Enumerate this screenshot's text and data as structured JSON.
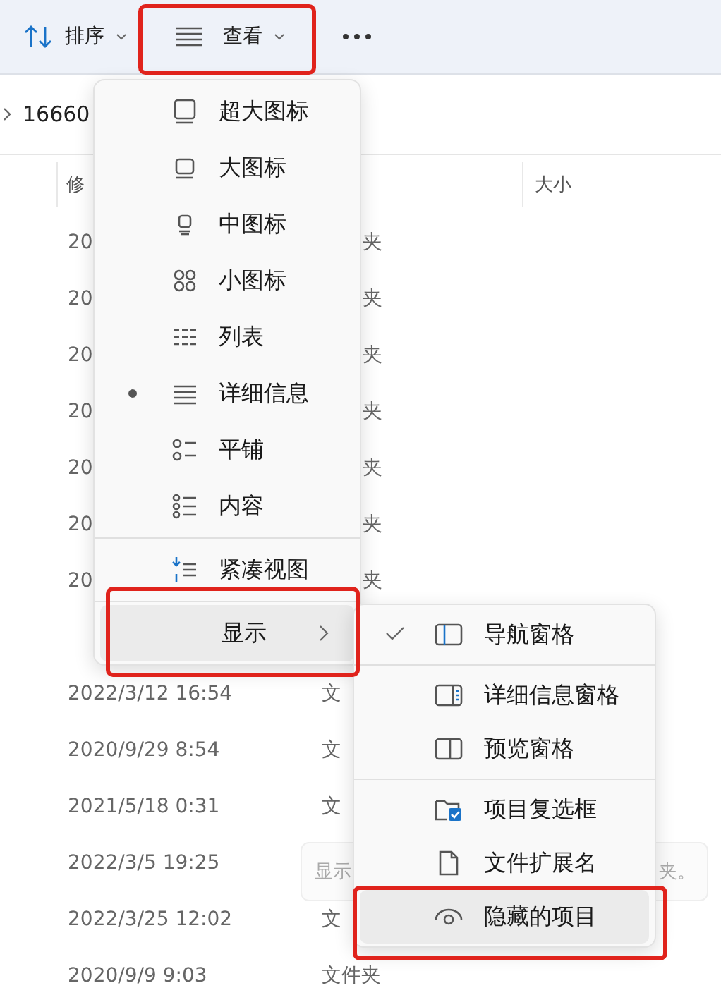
{
  "toolbar": {
    "sort": {
      "label": "排序"
    },
    "view": {
      "label": "查看"
    }
  },
  "breadcrumb": {
    "folder": "16660"
  },
  "table": {
    "columns": [
      "修",
      "大小"
    ],
    "rows": [
      {
        "kind": "covered",
        "date": "20",
        "type": "夹"
      },
      {
        "kind": "covered",
        "date": "20",
        "type": "夹"
      },
      {
        "kind": "covered",
        "date": "20",
        "type": "夹"
      },
      {
        "kind": "covered",
        "date": "20",
        "type": "夹"
      },
      {
        "kind": "covered",
        "date": "20",
        "type": "夹"
      },
      {
        "kind": "covered",
        "date": "20",
        "type": "夹"
      },
      {
        "kind": "covered",
        "date": "20",
        "type": "夹"
      },
      {
        "kind": "hidden"
      },
      {
        "kind": "partial",
        "date": "2022/3/12 16:54",
        "type": "文"
      },
      {
        "kind": "partial",
        "date": "2020/9/29 8:54",
        "type": "文"
      },
      {
        "kind": "partial",
        "date": "2021/5/18 0:31",
        "type": "文"
      },
      {
        "kind": "partial",
        "date": "2022/3/5 19:25"
      },
      {
        "kind": "partial",
        "date": "2022/3/25 12:02",
        "type": "文"
      },
      {
        "kind": "full",
        "date": "2020/9/9 9:03",
        "type": "文件夹"
      }
    ]
  },
  "view_menu": {
    "items": [
      {
        "label": "超大图标",
        "selected": false
      },
      {
        "label": "大图标",
        "selected": false
      },
      {
        "label": "中图标",
        "selected": false
      },
      {
        "label": "小图标",
        "selected": false
      },
      {
        "label": "列表",
        "selected": false
      },
      {
        "label": "详细信息",
        "selected": true
      },
      {
        "label": "平铺",
        "selected": false
      },
      {
        "label": "内容",
        "selected": false
      },
      {
        "label": "紧凑视图",
        "selected": false
      }
    ],
    "show": {
      "label": "显示",
      "expanded": true
    }
  },
  "show_menu": {
    "items": [
      {
        "label": "导航窗格",
        "checked": true,
        "highlighted": false
      },
      {
        "label": "详细信息窗格",
        "checked": false,
        "highlighted": false
      },
      {
        "label": "预览窗格",
        "checked": false,
        "highlighted": false
      },
      {
        "label": "项目复选框",
        "checked": false,
        "highlighted": false
      },
      {
        "label": "文件扩展名",
        "checked": false,
        "highlighted": false
      },
      {
        "label": "隐藏的项目",
        "checked": false,
        "highlighted": true
      }
    ]
  },
  "tooltip": {
    "left": "显示",
    "right": "夹。"
  }
}
